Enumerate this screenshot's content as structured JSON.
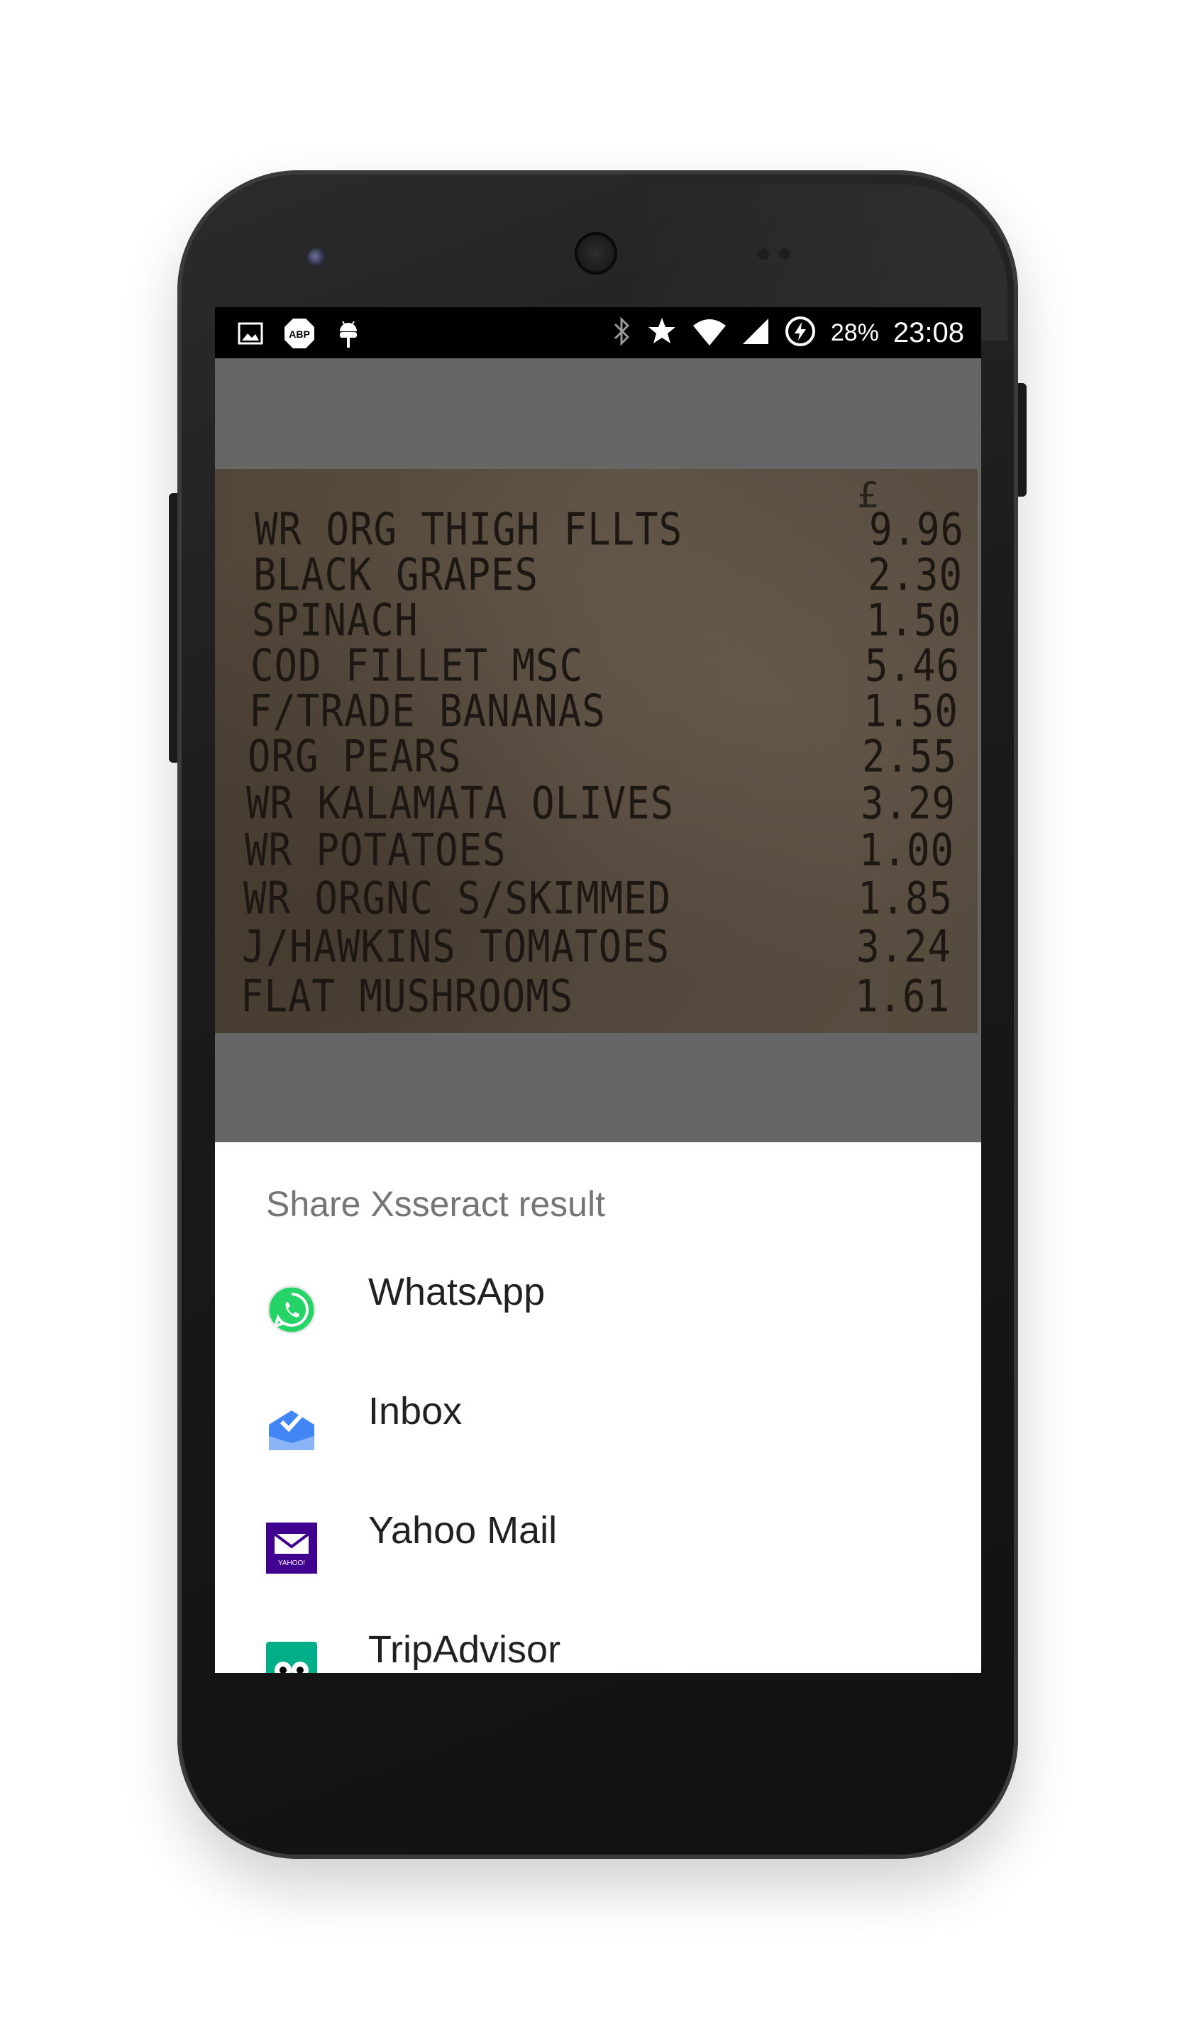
{
  "status_bar": {
    "battery_percent": "28%",
    "time": "23:08",
    "left_icons": [
      "image-icon",
      "abp-icon",
      "android-debug-icon"
    ],
    "right_icons": [
      "bluetooth-icon",
      "star-icon",
      "wifi-icon",
      "cell-signal-icon",
      "battery-saver-icon"
    ]
  },
  "receipt": {
    "currency": "£",
    "lines": [
      {
        "item": "WR ORG THIGH FLLTS",
        "price": "9.96"
      },
      {
        "item": "BLACK GRAPES",
        "price": "2.30"
      },
      {
        "item": "SPINACH",
        "price": "1.50"
      },
      {
        "item": "COD FILLET MSC",
        "price": "5.46"
      },
      {
        "item": "F/TRADE BANANAS",
        "price": "1.50"
      },
      {
        "item": "ORG PEARS",
        "price": "2.55"
      },
      {
        "item": "WR KALAMATA OLIVES",
        "price": "3.29"
      },
      {
        "item": "WR POTATOES",
        "price": "1.00"
      },
      {
        "item": "WR ORGNC S/SKIMMED",
        "price": "1.85"
      },
      {
        "item": "J/HAWKINS TOMATOES",
        "price": "3.24"
      },
      {
        "item": "FLAT MUSHROOMS",
        "price": "1.61"
      }
    ]
  },
  "share_sheet": {
    "title": "Share Xsseract result",
    "items": [
      {
        "label": "WhatsApp",
        "icon": "whatsapp-icon"
      },
      {
        "label": "Inbox",
        "icon": "inbox-icon"
      },
      {
        "label": "Yahoo Mail",
        "icon": "yahoo-mail-icon",
        "icon_text": "YAHOO!"
      },
      {
        "label": "TripAdvisor",
        "icon": "tripadvisor-icon"
      }
    ]
  },
  "colors": {
    "dim_overlay": "#666666",
    "whatsapp_green": "#25d366",
    "inbox_blue": "#4285f4",
    "yahoo_purple": "#400090",
    "tripadvisor_green": "#00af87"
  }
}
